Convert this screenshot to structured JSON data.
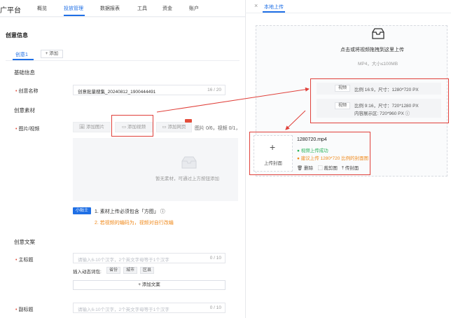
{
  "nav": {
    "brand": "广平台",
    "items": [
      {
        "label": "概览"
      },
      {
        "label": "投放管理"
      },
      {
        "label": "数据报表"
      },
      {
        "label": "工具"
      },
      {
        "label": "资金"
      },
      {
        "label": "账户"
      }
    ]
  },
  "form": {
    "section_title": "创意信息",
    "tab_active": "创意1",
    "tab_add": "+ 添加",
    "basic_info": "基础信息",
    "creative_name_label": "创意名称",
    "creative_name_value": "创意批量搜集_20240812_1900444491",
    "creative_name_counter": "16 / 20",
    "creative_material": "创意素材",
    "media_label": "图片/视频",
    "add_image": "添加图片",
    "add_video": "添加视频",
    "add_page": "添加网页",
    "media_counts": "图片 0/6，视频 0/1，",
    "empty_hint": "暂无素材，可通过上方按钮添加",
    "tip_badge": "小贴士",
    "tip_line1": "1. 素材上传必须包含「方图」",
    "tip_line2": "2. 若视频的编码为，视频对自行改编",
    "copy_section": "创意文案",
    "main_title_label": "主标题",
    "main_title_placeholder": "请输入6-10个汉字，2个英文字母等于1个汉字",
    "main_title_counter": "0 / 10",
    "dynamic_label": "插入动态词包:",
    "dynamic_words": [
      "省份",
      "城市",
      "区县"
    ],
    "add_copy": "+ 添加文案",
    "sub_title_label": "副标题",
    "sub_title_placeholder": "请输入6-10个汉字，2个英文字母等于1个汉字",
    "sub_title_counter": "0 / 10"
  },
  "drawer": {
    "close_glyph": "×",
    "title": "本地上传",
    "upload_hint": "点击或将视频拖拽到这里上传",
    "upload_format": "MP4，大小≤100MB",
    "spec1_chip": "视频",
    "spec1_text": "比例 16:9，尺寸：1280*720 PX",
    "spec2_chip": "视频",
    "spec2_text": "比例 9:16，尺寸：720*1280 PX",
    "spec2_sub": "内容展示区: 720*960 PX",
    "cover_plus": "+",
    "cover_label": "上传封面",
    "file_name": "1280720.mp4",
    "status_ok": "视频上传成功",
    "status_warn": "建议上传 1280*720 比例的封面图",
    "action_delete": "删除",
    "action_crop": "裁剪图",
    "action_cover": "传封面"
  },
  "colors": {
    "accent": "#1f6fe5",
    "annotation_red": "#e0403a",
    "success_green": "#2bb35a",
    "warning_orange": "#f08a1c"
  }
}
